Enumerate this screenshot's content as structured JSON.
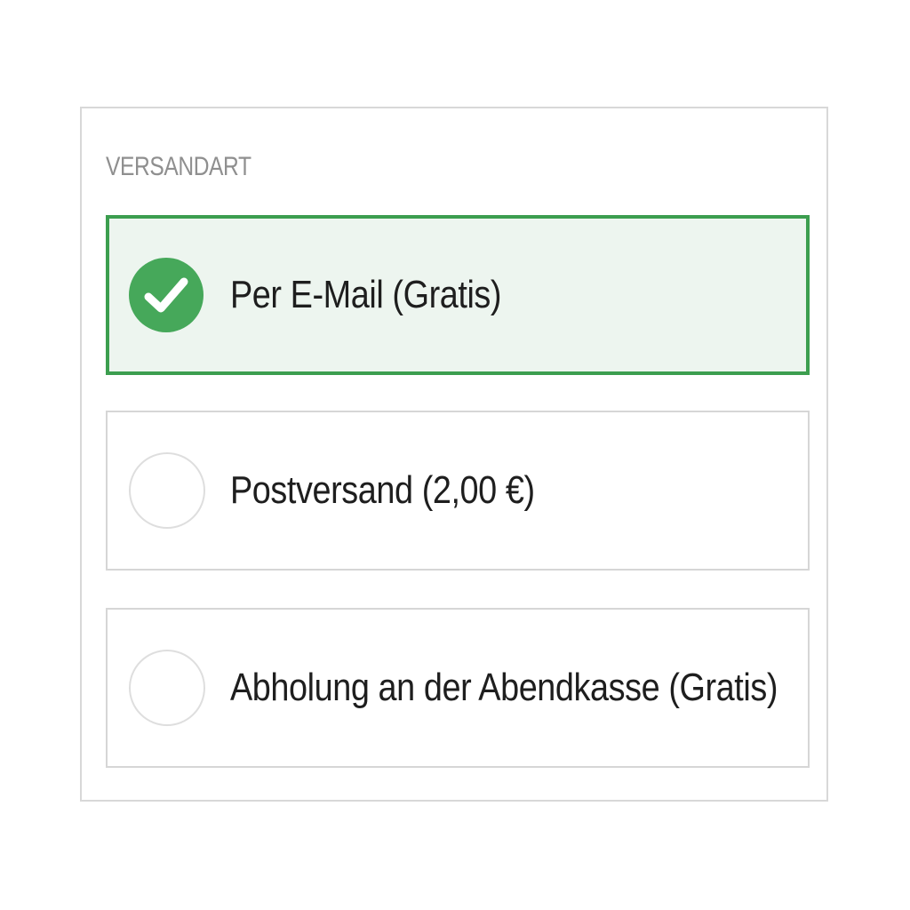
{
  "shipping": {
    "section_label": "VERSANDART",
    "options": [
      {
        "label": "Per E-Mail (Gratis)",
        "selected": true
      },
      {
        "label": "Postversand (2,00 €)",
        "selected": false
      },
      {
        "label": "Abholung an der Abendkasse (Gratis)",
        "selected": false
      }
    ]
  },
  "colors": {
    "accent": "#46a85a",
    "selected_border": "#3c9e4f",
    "selected_background": "#edf5ef",
    "label_gray": "#8f8f8f"
  },
  "icons": {
    "checked": "checkmark-icon",
    "unchecked": "empty-radio-circle"
  }
}
